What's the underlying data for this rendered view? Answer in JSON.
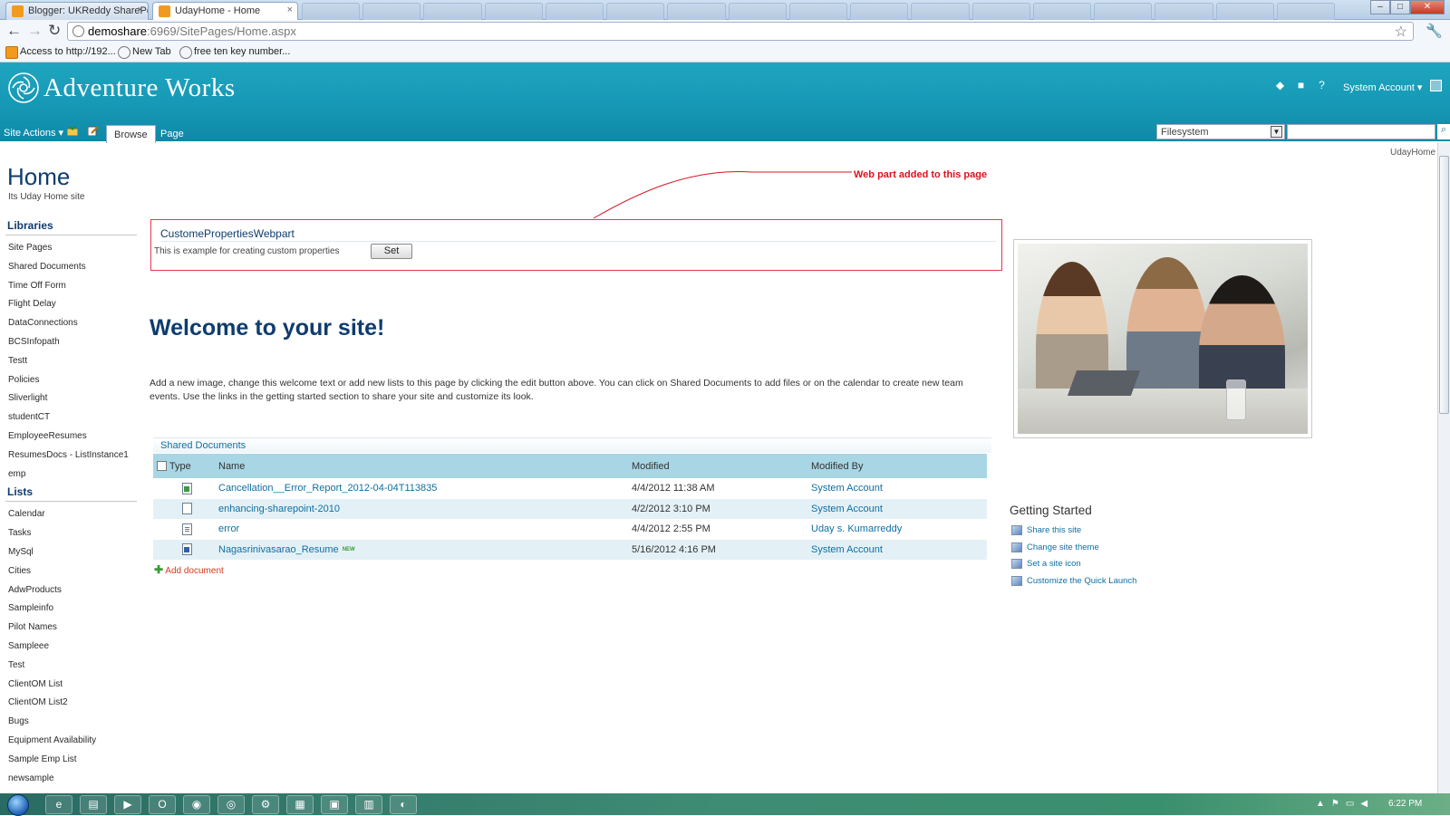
{
  "browser": {
    "tabs": [
      {
        "title": "Blogger: UKReddy SharePo",
        "close": "×"
      },
      {
        "title": "UdayHome - Home",
        "close": "×"
      }
    ],
    "url_host": "demoshare",
    "url_rest": ":6969/SitePages/Home.aspx",
    "bookmarks": [
      "Access to http://192...",
      "New Tab",
      "free ten key number..."
    ]
  },
  "header": {
    "site_title": "Adventure Works",
    "account": "System Account ▾",
    "site_actions": "Site Actions ▾",
    "tabs": [
      "Browse",
      "Page"
    ],
    "search_scope": "Filesystem",
    "username": "UdayHome"
  },
  "page": {
    "title": "Home",
    "subtitle": "Its Uday Home site"
  },
  "quicklaunch": {
    "libraries_heading": "Libraries",
    "libraries": [
      "Site Pages",
      "Shared Documents",
      "Time Off Form",
      "Flight Delay",
      "DataConnections",
      "BCSInfopath",
      "Testt",
      "Policies",
      "Sliverlight",
      "studentCT",
      "EmployeeResumes",
      "ResumesDocs - ListInstance1",
      "emp"
    ],
    "lists_heading": "Lists",
    "lists": [
      "Calendar",
      "Tasks",
      "MySql",
      "Cities",
      "AdwProducts",
      "Sampleinfo",
      "Pilot Names",
      "Sampleee",
      "Test",
      "ClientOM List",
      "ClientOM List2",
      "Bugs",
      "Equipment Availability",
      "Sample Emp List",
      "newsample"
    ]
  },
  "webpart": {
    "annotation": "Web part added to this page",
    "title": "CustomePropertiesWebpart",
    "text": "This is example for creating custom properties",
    "button": "Set"
  },
  "welcome": {
    "heading": "Welcome to your site!",
    "body": "Add a new image, change this welcome text or add new lists to this page by clicking the edit button above. You can click on Shared Documents to add files or on the calendar to create new team events. Use the links in the getting started section to share your site and customize its look."
  },
  "shared_documents": {
    "title": "Shared Documents",
    "columns": [
      "Type",
      "Name",
      "Modified",
      "Modified By"
    ],
    "rows": [
      {
        "icon": "excel-doc-icon",
        "name": "Cancellation__Error_Report_2012-04-04T113835",
        "modified": "4/4/2012 11:38 AM",
        "modified_by": "System Account"
      },
      {
        "icon": "blank-doc-icon",
        "name": "enhancing-sharepoint-2010",
        "modified": "4/2/2012 3:10 PM",
        "modified_by": "System Account"
      },
      {
        "icon": "text-doc-icon",
        "name": "error",
        "modified": "4/4/2012 2:55 PM",
        "modified_by": "Uday s. Kumarreddy"
      },
      {
        "icon": "word-doc-icon",
        "name": "Nagasrinivasarao_Resume",
        "new_badge": "NEW",
        "modified": "5/16/2012 4:16 PM",
        "modified_by": "System Account"
      }
    ],
    "add_label": "Add document"
  },
  "getting_started": {
    "title": "Getting Started",
    "items": [
      "Share this site",
      "Change site theme",
      "Set a site icon",
      "Customize the Quick Launch"
    ]
  },
  "taskbar": {
    "clock": "6:22 PM"
  },
  "colors": {
    "header_teal": "#1597b4",
    "annotation_red": "#d8141f",
    "title_navy": "#0f3c6e",
    "link_blue": "#0f6fa3"
  }
}
